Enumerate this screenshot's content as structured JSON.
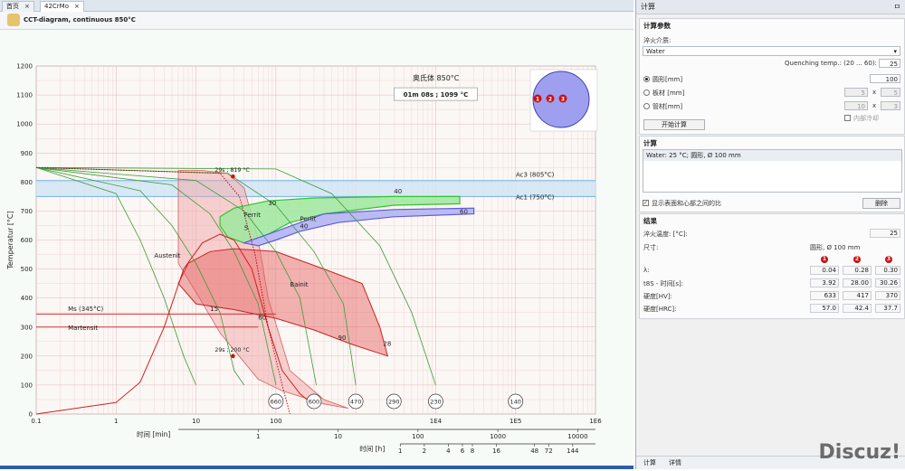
{
  "tabs": [
    {
      "label": "首页"
    },
    {
      "label": "42CrMo"
    }
  ],
  "header": {
    "title": "CCT-diagram, continuous 850°C"
  },
  "chart_data": {
    "type": "line",
    "title": "奥氏体 850°C",
    "info_box": "01m 08s ; 1099 °C",
    "ylabel": "Temperatur [°C]",
    "ylim": [
      0,
      1200
    ],
    "yticks": [
      "0",
      "100",
      "200",
      "300",
      "400",
      "500",
      "600",
      "700",
      "800",
      "900",
      "1000",
      "1100",
      "1200"
    ],
    "xscale": "log",
    "xlim": [
      0.1,
      1000000
    ],
    "xticks": [
      "0.1",
      "1",
      "10",
      "100",
      "1E4",
      "1E5",
      "1E6"
    ],
    "xtick_values": [
      0.1,
      1,
      10,
      100,
      10000,
      100000,
      1000000
    ],
    "xmin_label": "时间 [min]",
    "xmin_ticks": [
      "1",
      "10",
      "100",
      "1000",
      "10000"
    ],
    "xh_label": "时间 [h]",
    "xh_ticks": [
      "1",
      "2",
      "4",
      "6",
      "8",
      "16",
      "48",
      "72",
      "144"
    ],
    "ac3": {
      "label": "Ac3 (805°C)",
      "value": 805
    },
    "ac1": {
      "label": "Ac1 (750°C)",
      "value": 750
    },
    "ms": {
      "label": "Ms (345°C)",
      "value": 345
    },
    "phase_labels": {
      "austenit": "Austenit",
      "ferrit": "Ferrit",
      "perlit": "Perlit",
      "bainit": "Bainit",
      "martensit": "Martensit"
    },
    "zone_values": [
      "30",
      "40",
      "40",
      "5",
      "60",
      "15",
      "60",
      "90",
      "28"
    ],
    "markers": [
      {
        "label": "29s ; 819 °C",
        "t": 29,
        "temp": 819
      },
      {
        "label": "29s ; 200 °C",
        "t": 29,
        "temp": 200
      }
    ],
    "hardness": [
      {
        "value": "660",
        "t": 10
      },
      {
        "value": "600",
        "t": 30
      },
      {
        "value": "470",
        "t": 100
      },
      {
        "value": "290",
        "t": 300
      },
      {
        "value": "230",
        "t": 1000
      },
      {
        "value": "140",
        "t": 10000
      }
    ],
    "cooling_curves": [
      {
        "name": "c1",
        "points": [
          [
            0.1,
            850
          ],
          [
            1,
            760
          ],
          [
            2,
            600
          ],
          [
            4,
            400
          ],
          [
            7,
            200
          ],
          [
            10,
            100
          ]
        ]
      },
      {
        "name": "c2",
        "points": [
          [
            0.1,
            850
          ],
          [
            2,
            770
          ],
          [
            5,
            650
          ],
          [
            10,
            520
          ],
          [
            20,
            350
          ],
          [
            30,
            150
          ],
          [
            40,
            100
          ]
        ]
      },
      {
        "name": "c3",
        "points": [
          [
            0.1,
            850
          ],
          [
            5,
            790
          ],
          [
            15,
            690
          ],
          [
            30,
            560
          ],
          [
            60,
            380
          ],
          [
            100,
            100
          ]
        ]
      },
      {
        "name": "c4",
        "points": [
          [
            0.1,
            850
          ],
          [
            10,
            805
          ],
          [
            40,
            700
          ],
          [
            100,
            560
          ],
          [
            200,
            400
          ],
          [
            320,
            100
          ]
        ]
      },
      {
        "name": "c5",
        "points": [
          [
            0.1,
            850
          ],
          [
            25,
            830
          ],
          [
            100,
            720
          ],
          [
            300,
            560
          ],
          [
            700,
            380
          ],
          [
            1000,
            100
          ]
        ]
      },
      {
        "name": "c6",
        "points": [
          [
            0.1,
            850
          ],
          [
            100,
            845
          ],
          [
            500,
            760
          ],
          [
            2000,
            580
          ],
          [
            5000,
            350
          ],
          [
            10000,
            100
          ]
        ]
      }
    ],
    "phase_regions": {
      "ferrit": [
        [
          20,
          680
        ],
        [
          30,
          710
        ],
        [
          80,
          735
        ],
        [
          300,
          745
        ],
        [
          3000,
          750
        ],
        [
          20000,
          750
        ],
        [
          20000,
          725
        ],
        [
          3000,
          720
        ],
        [
          400,
          690
        ],
        [
          150,
          660
        ],
        [
          80,
          620
        ],
        [
          40,
          590
        ],
        [
          25,
          610
        ],
        [
          20,
          650
        ]
      ],
      "perlit": [
        [
          40,
          590
        ],
        [
          80,
          620
        ],
        [
          400,
          690
        ],
        [
          3000,
          705
        ],
        [
          30000,
          710
        ],
        [
          30000,
          690
        ],
        [
          3000,
          680
        ],
        [
          600,
          660
        ],
        [
          200,
          630
        ],
        [
          100,
          600
        ],
        [
          60,
          580
        ],
        [
          40,
          590
        ]
      ],
      "bainit": [
        [
          6,
          450
        ],
        [
          8,
          520
        ],
        [
          15,
          560
        ],
        [
          30,
          570
        ],
        [
          100,
          560
        ],
        [
          400,
          500
        ],
        [
          1200,
          450
        ],
        [
          2000,
          300
        ],
        [
          2500,
          200
        ],
        [
          900,
          240
        ],
        [
          300,
          290
        ],
        [
          100,
          330
        ],
        [
          30,
          360
        ],
        [
          10,
          380
        ],
        [
          6,
          450
        ]
      ],
      "austenit": [
        [
          6,
          840
        ],
        [
          12,
          840
        ],
        [
          25,
          830
        ],
        [
          40,
          780
        ],
        [
          60,
          600
        ],
        [
          80,
          400
        ],
        [
          150,
          150
        ],
        [
          400,
          50
        ],
        [
          800,
          20
        ],
        [
          400,
          35
        ],
        [
          120,
          80
        ],
        [
          60,
          120
        ],
        [
          20,
          280
        ],
        [
          10,
          420
        ],
        [
          6,
          520
        ]
      ]
    },
    "critical_curve": [
      [
        0.1,
        0
      ],
      [
        1,
        40
      ],
      [
        2,
        110
      ],
      [
        4,
        300
      ],
      [
        7,
        500
      ],
      [
        12,
        590
      ],
      [
        20,
        620
      ],
      [
        30,
        600
      ],
      [
        50,
        500
      ],
      [
        80,
        300
      ],
      [
        120,
        150
      ],
      [
        200,
        70
      ],
      [
        300,
        30
      ]
    ],
    "dotted_curve": [
      [
        0.1,
        850
      ],
      [
        20,
        830
      ],
      [
        35,
        750
      ],
      [
        55,
        550
      ],
      [
        80,
        300
      ],
      [
        120,
        100
      ],
      [
        150,
        0
      ]
    ],
    "inset_points": [
      "1",
      "2",
      "3"
    ]
  },
  "panel": {
    "title": "计算",
    "pin": "ㅁ",
    "params": {
      "title": "计算参数",
      "medium_label": "淬火介质:",
      "medium_value": "Water",
      "temp_label": "Quenching temp.: (20 ... 60):",
      "temp_value": "25",
      "round_label": "圆形[mm]",
      "round_value": "100",
      "plate_label": "板材 [mm]",
      "plate_a": "5",
      "plate_b": "5",
      "tube_label": "管材[mm]",
      "tube_a": "10",
      "tube_b": "3",
      "x_sep": "x",
      "inner_label": "内部冷却",
      "start_button": "开始计算"
    },
    "calc": {
      "title": "计算",
      "item": "Water: 25 °C; 圆形, Ø 100 mm",
      "show_label": "显示表面和心部之间的比",
      "delete_button": "删除"
    },
    "results": {
      "title": "结果",
      "temp_label": "淬火温度: [°C]:",
      "temp_value": "25",
      "size_label": "尺寸:",
      "size_value": "圆形, Ø 100 mm",
      "col_badges": [
        "1",
        "2",
        "3"
      ],
      "rows": [
        {
          "label": "λ:",
          "values": [
            "0.04",
            "0.28",
            "0.30"
          ]
        },
        {
          "label": "t8S - 时间[s]:",
          "values": [
            "3.92",
            "28.00",
            "30.26"
          ]
        },
        {
          "label": "硬度[HV]:",
          "values": [
            "633",
            "417",
            "370"
          ]
        },
        {
          "label": "硬度[HRC]:",
          "values": [
            "57.0",
            "42.4",
            "37.7"
          ]
        }
      ]
    },
    "bottom_tabs": [
      "计算",
      "详情"
    ]
  },
  "watermark": "Discuz!",
  "colors": {
    "grid_major": "#e0b7b7",
    "grid_minor": "#f1d6d6",
    "cooling": "#3c9b3c",
    "bainit": "#e45a5a",
    "ferrit": "#35c135",
    "perlit": "#5e5ed8",
    "ac_band": "#cfe4f5",
    "ac_line": "#6fb3e5",
    "critical": "#d02020"
  }
}
